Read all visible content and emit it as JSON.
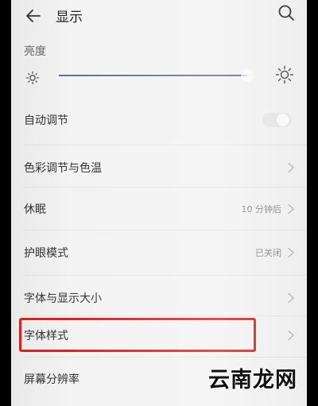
{
  "header": {
    "title": "显示"
  },
  "brightness": {
    "label": "亮度",
    "level_fraction": 0.98,
    "fill_color": "#6669aa"
  },
  "rows": [
    {
      "label": "自动调节",
      "type": "toggle",
      "value": "",
      "enabled": false
    },
    {
      "label": "色彩调节与色温",
      "type": "link",
      "value": ""
    },
    {
      "label": "休眠",
      "type": "link",
      "value": "10 分钟后"
    },
    {
      "label": "护眼模式",
      "type": "link",
      "value": "已关闭"
    },
    {
      "label": "字体与显示大小",
      "type": "link",
      "value": ""
    },
    {
      "label": "字体样式",
      "type": "link",
      "value": "",
      "highlighted": true
    },
    {
      "label": "屏幕分辨率",
      "type": "link",
      "value": ""
    }
  ],
  "annotation": {
    "highlight_color": "#e02020"
  },
  "watermark": {
    "text": "云南龙网"
  },
  "icons": {
    "back": "arrow-left-icon",
    "search": "search-icon",
    "brightness_low": "sun-small-icon",
    "brightness_high": "sun-large-icon",
    "row_arrow": "chevron-right-icon"
  }
}
